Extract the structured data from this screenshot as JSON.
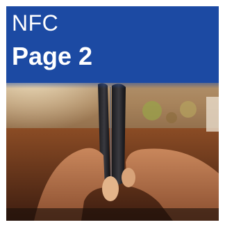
{
  "banner": {
    "line1": "NFC",
    "line2": "Page 2"
  },
  "photo": {
    "subject": "two-smartphones-touching-back-to-back",
    "icon": "photo-icon"
  },
  "colors": {
    "banner": "#1c4aa3",
    "text": "#ffffff",
    "page_background": "#ffffff"
  }
}
